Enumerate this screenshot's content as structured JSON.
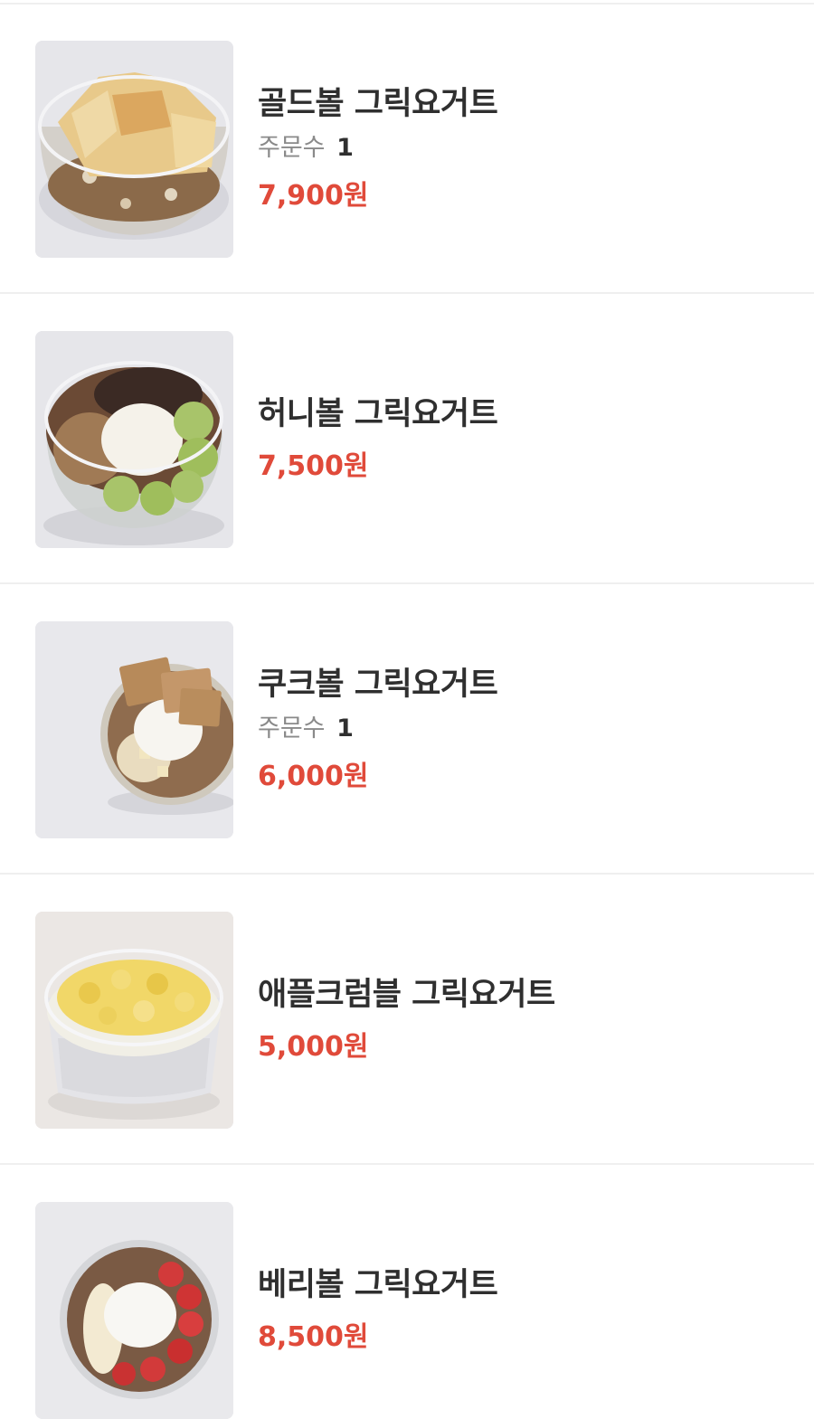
{
  "menu_items": [
    {
      "name": "골드볼 그릭요거트",
      "orders_label": "주문수",
      "orders_count": "1",
      "price": "7,900원",
      "image": "gold-ball-yogurt-photo"
    },
    {
      "name": "허니볼 그릭요거트",
      "price": "7,500원",
      "image": "honey-ball-yogurt-photo"
    },
    {
      "name": "쿠크볼 그릭요거트",
      "orders_label": "주문수",
      "orders_count": "1",
      "price": "6,000원",
      "image": "cookie-ball-yogurt-photo"
    },
    {
      "name": "애플크럼블 그릭요거트",
      "price": "5,000원",
      "image": "apple-crumble-yogurt-photo"
    },
    {
      "name": "베리볼 그릭요거트",
      "price": "8,500원",
      "image": "berry-ball-yogurt-photo"
    }
  ],
  "colors": {
    "price": "#e04a3a",
    "name": "#2f2f2f",
    "orders_label": "#8a8a8a",
    "divider": "#efefef"
  }
}
